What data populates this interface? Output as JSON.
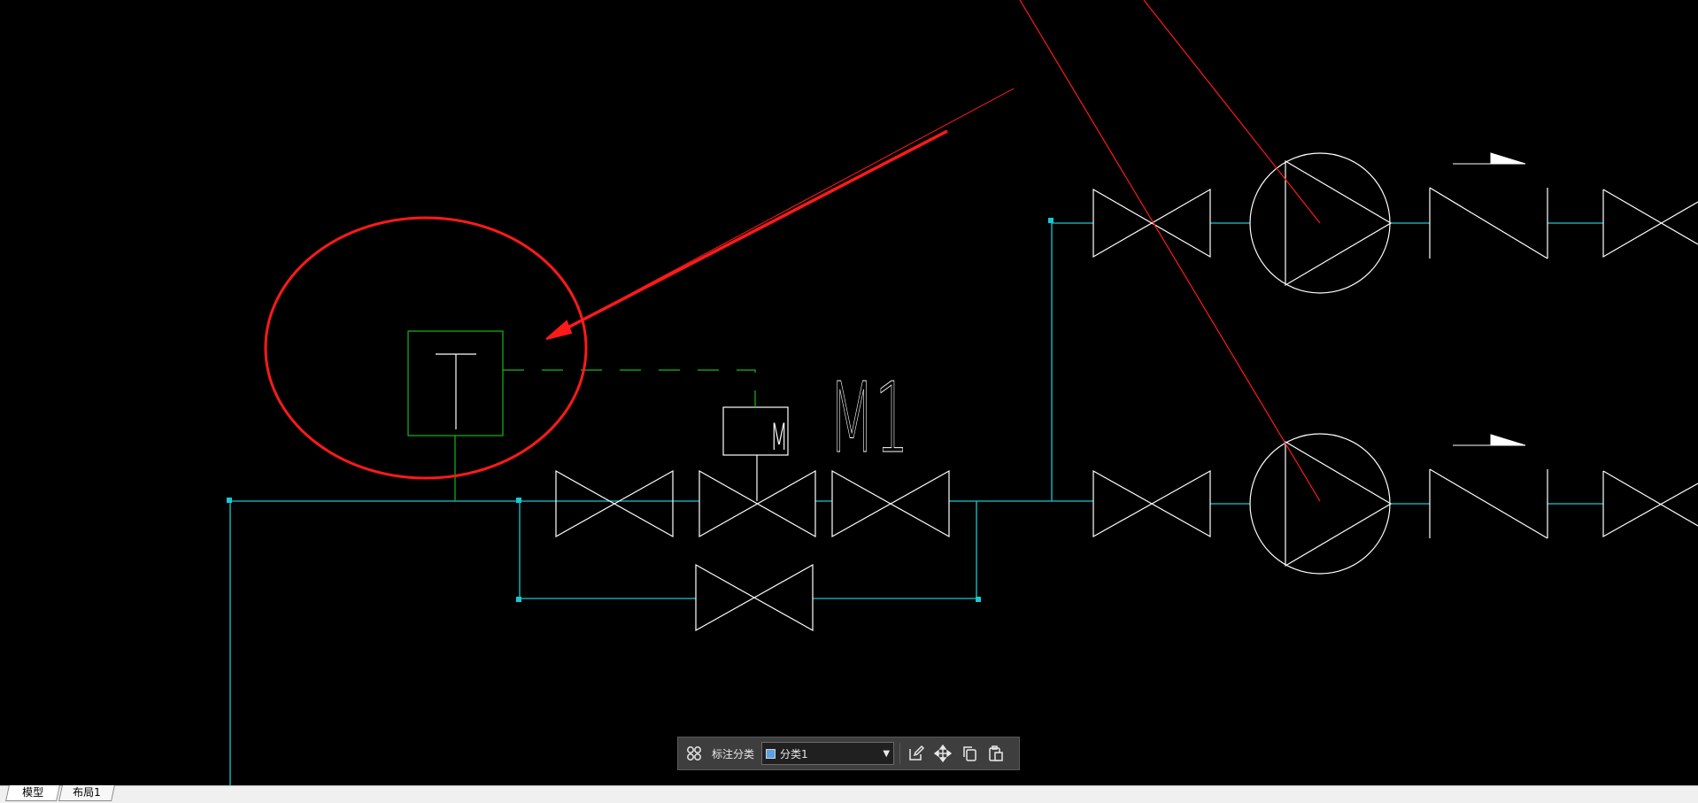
{
  "drawing": {
    "motor_label": "M",
    "tag_label": "M1",
    "transmitter_symbol": "T"
  },
  "toolbar": {
    "group_icon": "grid-icon",
    "category_label": "标注分类",
    "category_value": "分类1",
    "swatch_color": "#5aa0e6",
    "actions": [
      "edit-icon",
      "move-icon",
      "copy-icon",
      "paste-icon"
    ]
  },
  "tabs": {
    "model": "模型",
    "layout1": "布局1"
  },
  "colors": {
    "pipe": "#19c8d2",
    "signal": "#18b818",
    "symbol": "#ffffff",
    "annotation": "#ff1a1a"
  }
}
